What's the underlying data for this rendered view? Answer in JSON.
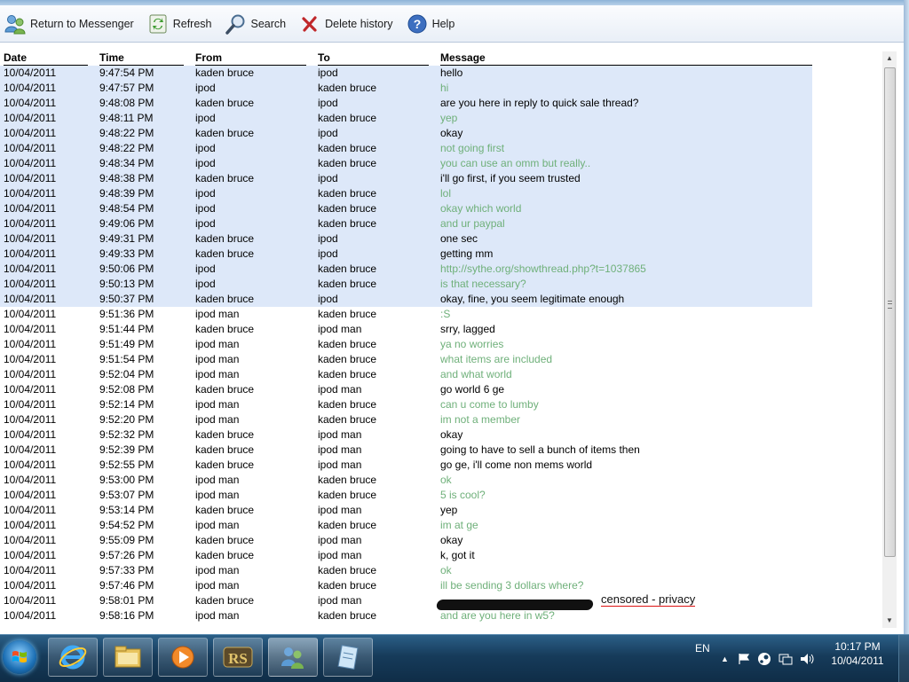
{
  "toolbar": {
    "return_label": "Return to Messenger",
    "refresh_label": "Refresh",
    "search_label": "Search",
    "delete_label": "Delete history",
    "help_label": "Help"
  },
  "columns": [
    "Date",
    "Time",
    "From",
    "To",
    "Message"
  ],
  "rows": [
    {
      "date": "10/04/2011",
      "time": "9:47:54 PM",
      "from": "kaden bruce",
      "to": "ipod",
      "msg": "hello",
      "hl": true,
      "green": false
    },
    {
      "date": "10/04/2011",
      "time": "9:47:57 PM",
      "from": "ipod",
      "to": "kaden bruce",
      "msg": "hi",
      "hl": true,
      "green": true
    },
    {
      "date": "10/04/2011",
      "time": "9:48:08 PM",
      "from": "kaden bruce",
      "to": "ipod",
      "msg": "are you here in reply to quick sale thread?",
      "hl": true,
      "green": false
    },
    {
      "date": "10/04/2011",
      "time": "9:48:11 PM",
      "from": "ipod",
      "to": "kaden bruce",
      "msg": "yep",
      "hl": true,
      "green": true
    },
    {
      "date": "10/04/2011",
      "time": "9:48:22 PM",
      "from": "kaden bruce",
      "to": "ipod",
      "msg": "okay",
      "hl": true,
      "green": false
    },
    {
      "date": "10/04/2011",
      "time": "9:48:22 PM",
      "from": "ipod",
      "to": "kaden bruce",
      "msg": "not going first",
      "hl": true,
      "green": true
    },
    {
      "date": "10/04/2011",
      "time": "9:48:34 PM",
      "from": "ipod",
      "to": "kaden bruce",
      "msg": "you can use an omm but really..",
      "hl": true,
      "green": true
    },
    {
      "date": "10/04/2011",
      "time": "9:48:38 PM",
      "from": "kaden bruce",
      "to": "ipod",
      "msg": "i'll go first, if you seem trusted",
      "hl": true,
      "green": false
    },
    {
      "date": "10/04/2011",
      "time": "9:48:39 PM",
      "from": "ipod",
      "to": "kaden bruce",
      "msg": "lol",
      "hl": true,
      "green": true
    },
    {
      "date": "10/04/2011",
      "time": "9:48:54 PM",
      "from": "ipod",
      "to": "kaden bruce",
      "msg": "okay which world",
      "hl": true,
      "green": true
    },
    {
      "date": "10/04/2011",
      "time": "9:49:06 PM",
      "from": "ipod",
      "to": "kaden bruce",
      "msg": "and ur paypal",
      "hl": true,
      "green": true
    },
    {
      "date": "10/04/2011",
      "time": "9:49:31 PM",
      "from": "kaden bruce",
      "to": "ipod",
      "msg": "one sec",
      "hl": true,
      "green": false
    },
    {
      "date": "10/04/2011",
      "time": "9:49:33 PM",
      "from": "kaden bruce",
      "to": "ipod",
      "msg": "getting mm",
      "hl": true,
      "green": false
    },
    {
      "date": "10/04/2011",
      "time": "9:50:06 PM",
      "from": "ipod",
      "to": "kaden bruce",
      "msg": "http://sythe.org/showthread.php?t=1037865",
      "hl": true,
      "green": true
    },
    {
      "date": "10/04/2011",
      "time": "9:50:13 PM",
      "from": "ipod",
      "to": "kaden bruce",
      "msg": "is that necessary?",
      "hl": true,
      "green": true
    },
    {
      "date": "10/04/2011",
      "time": "9:50:37 PM",
      "from": "kaden bruce",
      "to": "ipod",
      "msg": "okay, fine, you seem legitimate enough",
      "hl": true,
      "green": false
    },
    {
      "date": "10/04/2011",
      "time": "9:51:36 PM",
      "from": "ipod man",
      "to": "kaden bruce",
      "msg": ":S",
      "hl": false,
      "green": true
    },
    {
      "date": "10/04/2011",
      "time": "9:51:44 PM",
      "from": "kaden bruce",
      "to": "ipod man",
      "msg": "srry, lagged",
      "hl": false,
      "green": false
    },
    {
      "date": "10/04/2011",
      "time": "9:51:49 PM",
      "from": "ipod man",
      "to": "kaden bruce",
      "msg": "ya no worries",
      "hl": false,
      "green": true
    },
    {
      "date": "10/04/2011",
      "time": "9:51:54 PM",
      "from": "ipod man",
      "to": "kaden bruce",
      "msg": "what items are included",
      "hl": false,
      "green": true
    },
    {
      "date": "10/04/2011",
      "time": "9:52:04 PM",
      "from": "ipod man",
      "to": "kaden bruce",
      "msg": "and what world",
      "hl": false,
      "green": true
    },
    {
      "date": "10/04/2011",
      "time": "9:52:08 PM",
      "from": "kaden bruce",
      "to": "ipod man",
      "msg": "go world 6 ge",
      "hl": false,
      "green": false
    },
    {
      "date": "10/04/2011",
      "time": "9:52:14 PM",
      "from": "ipod man",
      "to": "kaden bruce",
      "msg": "can u come to lumby",
      "hl": false,
      "green": true
    },
    {
      "date": "10/04/2011",
      "time": "9:52:20 PM",
      "from": "ipod man",
      "to": "kaden bruce",
      "msg": "im not a member",
      "hl": false,
      "green": true
    },
    {
      "date": "10/04/2011",
      "time": "9:52:32 PM",
      "from": "kaden bruce",
      "to": "ipod man",
      "msg": "okay",
      "hl": false,
      "green": false
    },
    {
      "date": "10/04/2011",
      "time": "9:52:39 PM",
      "from": "kaden bruce",
      "to": "ipod man",
      "msg": "going to have to sell a bunch of items then",
      "hl": false,
      "green": false
    },
    {
      "date": "10/04/2011",
      "time": "9:52:55 PM",
      "from": "kaden bruce",
      "to": "ipod man",
      "msg": "go ge, i'll come non mems world",
      "hl": false,
      "green": false
    },
    {
      "date": "10/04/2011",
      "time": "9:53:00 PM",
      "from": "ipod man",
      "to": "kaden bruce",
      "msg": "ok",
      "hl": false,
      "green": true
    },
    {
      "date": "10/04/2011",
      "time": "9:53:07 PM",
      "from": "ipod man",
      "to": "kaden bruce",
      "msg": "5 is cool?",
      "hl": false,
      "green": true
    },
    {
      "date": "10/04/2011",
      "time": "9:53:14 PM",
      "from": "kaden bruce",
      "to": "ipod man",
      "msg": "yep",
      "hl": false,
      "green": false
    },
    {
      "date": "10/04/2011",
      "time": "9:54:52 PM",
      "from": "ipod man",
      "to": "kaden bruce",
      "msg": "im at ge",
      "hl": false,
      "green": true
    },
    {
      "date": "10/04/2011",
      "time": "9:55:09 PM",
      "from": "kaden bruce",
      "to": "ipod man",
      "msg": "okay",
      "hl": false,
      "green": false
    },
    {
      "date": "10/04/2011",
      "time": "9:57:26 PM",
      "from": "kaden bruce",
      "to": "ipod man",
      "msg": "k, got it",
      "hl": false,
      "green": false
    },
    {
      "date": "10/04/2011",
      "time": "9:57:33 PM",
      "from": "ipod man",
      "to": "kaden bruce",
      "msg": "ok",
      "hl": false,
      "green": true
    },
    {
      "date": "10/04/2011",
      "time": "9:57:46 PM",
      "from": "ipod man",
      "to": "kaden bruce",
      "msg": "ill be sending 3 dollars where?",
      "hl": false,
      "green": true
    },
    {
      "date": "10/04/2011",
      "time": "9:58:01 PM",
      "from": "kaden bruce",
      "to": "ipod man",
      "msg": "",
      "hl": false,
      "green": false
    },
    {
      "date": "10/04/2011",
      "time": "9:58:16 PM",
      "from": "ipod man",
      "to": "kaden bruce",
      "msg": "and are you here in w5?",
      "hl": false,
      "green": true
    }
  ],
  "annotation": "censored - privacy",
  "taskbar": {
    "lang": "EN",
    "time": "10:17 PM",
    "date": "10/04/2011",
    "apps": [
      "internet-explorer-icon",
      "explorer-icon",
      "media-player-icon",
      "runescape-icon",
      "messenger-icon",
      "notepad-icon"
    ]
  },
  "colors": {
    "highlight": "#dde8f9",
    "green_text": "#6fb07a",
    "taskbar": "#163b5a"
  }
}
